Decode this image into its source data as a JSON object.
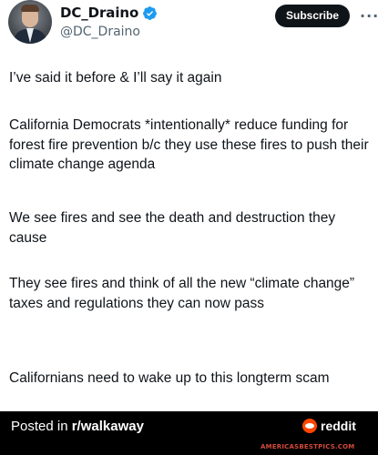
{
  "author": {
    "display_name": "DC_Draino",
    "handle": "@DC_Draino",
    "verified_color": "#1d9bf0"
  },
  "actions": {
    "subscribe_label": "Subscribe",
    "more_label": "···"
  },
  "tweet": {
    "paragraphs": [
      "I’ve said it before & I’ll say it again",
      "California Democrats *intentionally* reduce funding for forest fire prevention b/c they use these fires to push their climate change agenda",
      "We see fires and see the death and destruction they cause",
      "They see fires and think of all the new “climate change” taxes and regulations they can now pass",
      "Californians need to wake up to this longterm scam"
    ]
  },
  "footer": {
    "posted_prefix": "Posted in ",
    "subreddit": "r/walkaway",
    "reddit_label": "reddit",
    "watermark": "AMERICASBESTPICS.COM",
    "reddit_color": "#ff4500"
  }
}
